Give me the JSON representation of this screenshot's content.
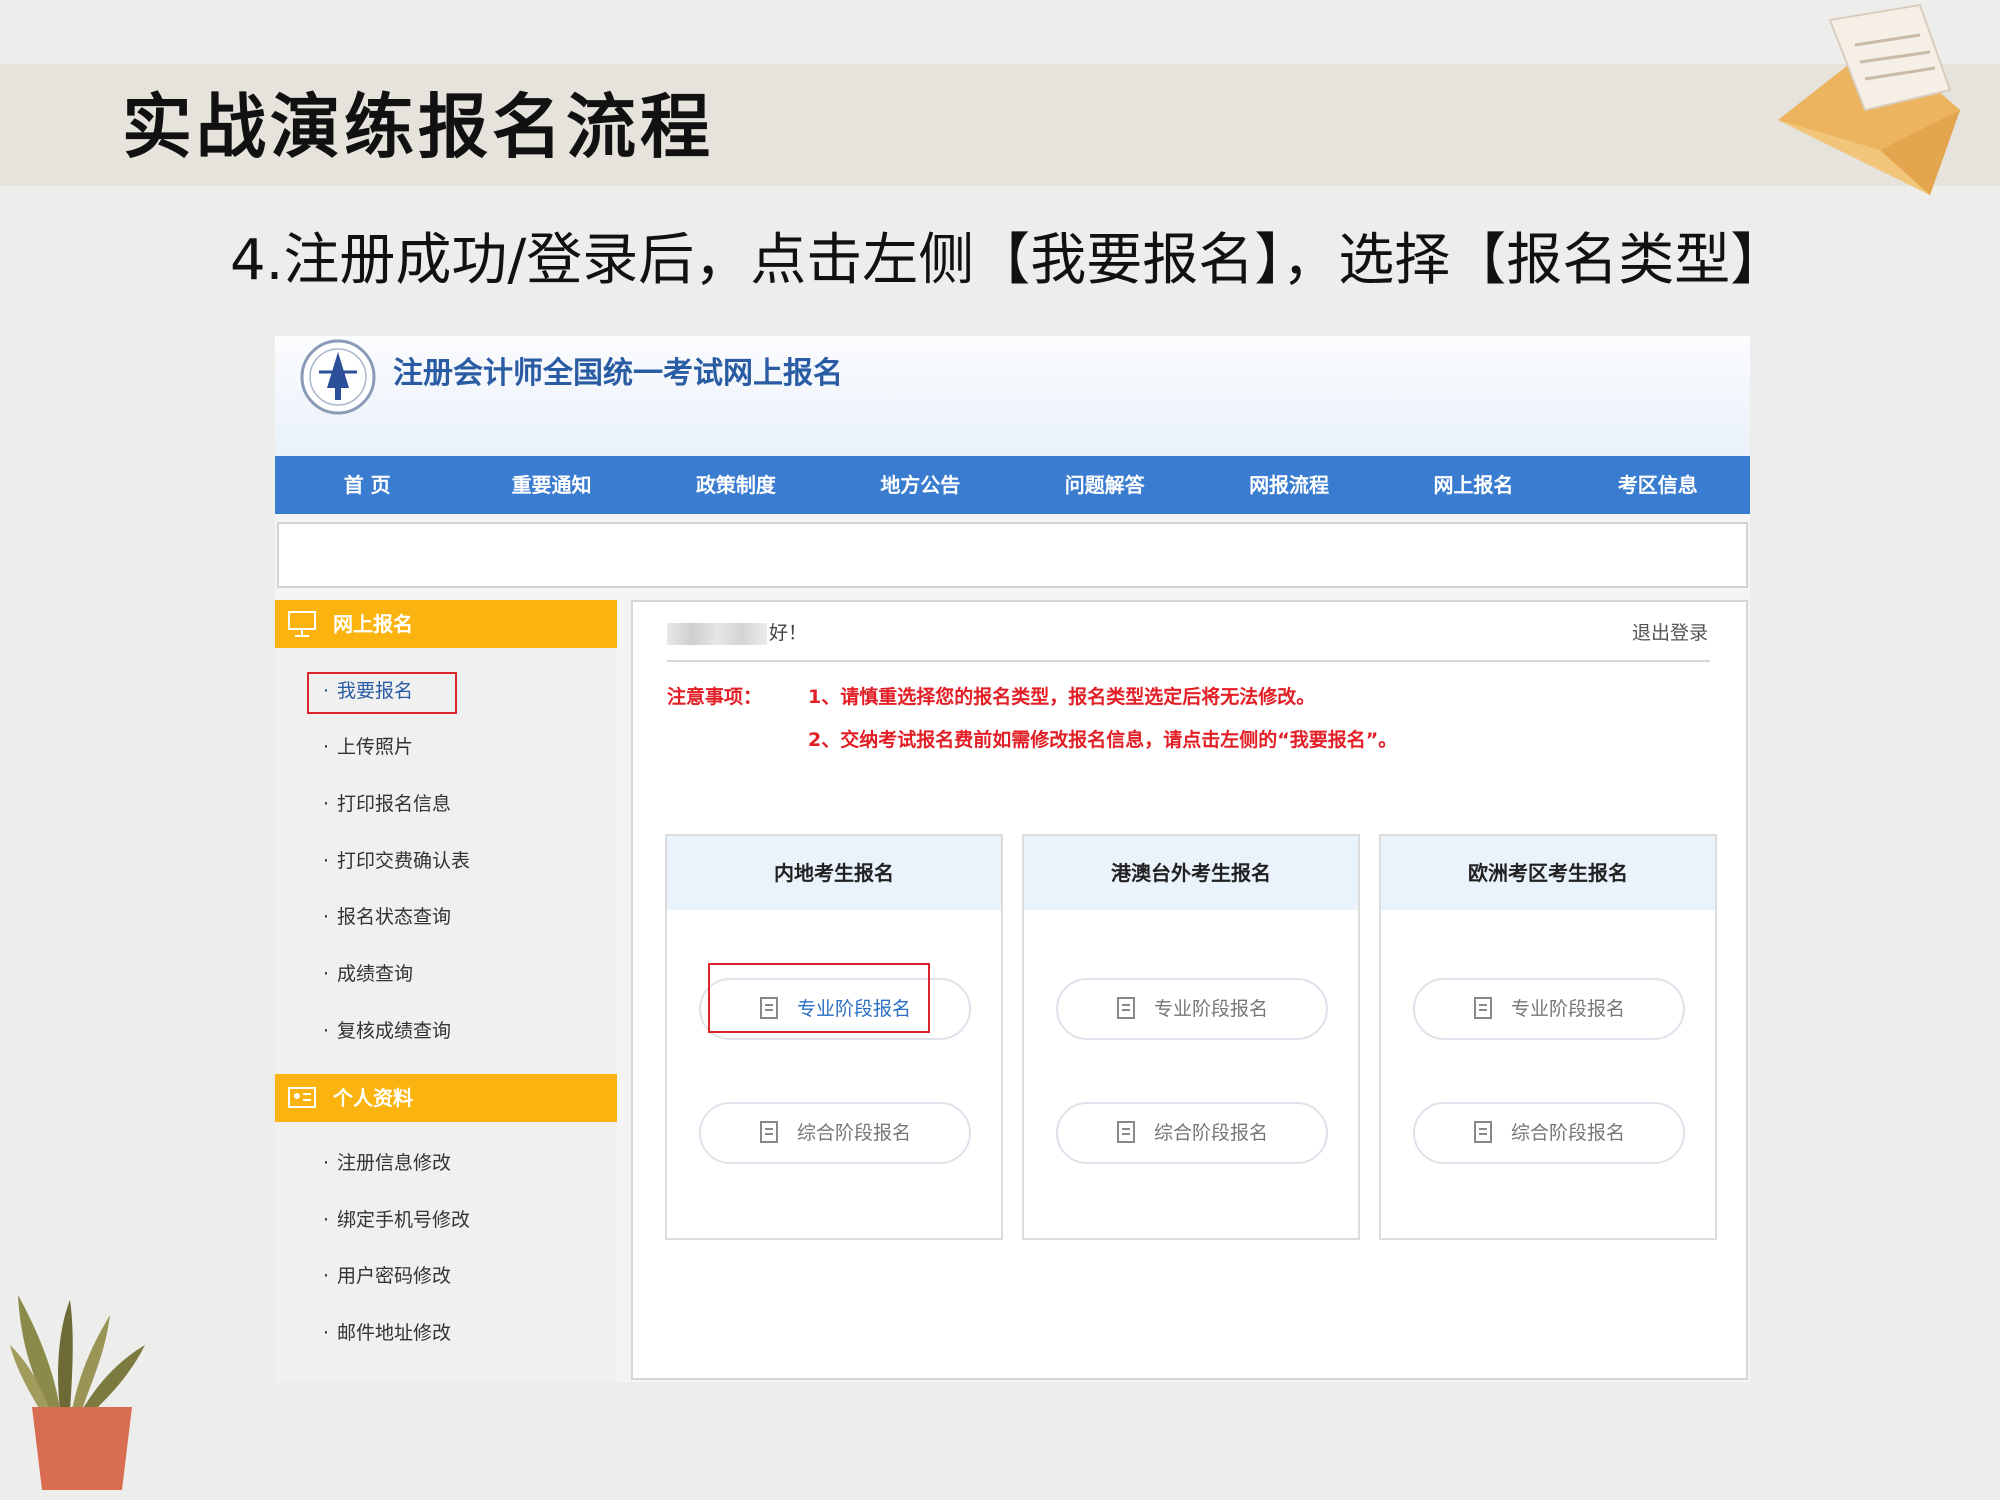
{
  "slide": {
    "title": "实战演练报名流程",
    "subtitle": "4.注册成功/登录后，点击左侧【我要报名】，选择【报名类型】"
  },
  "site": {
    "title": "注册会计师全国统一考试网上报名",
    "nav": [
      "首 页",
      "重要通知",
      "政策制度",
      "地方公告",
      "问题解答",
      "网报流程",
      "网上报名",
      "考区信息"
    ]
  },
  "sidebar": {
    "section1": {
      "label": "网上报名",
      "items": [
        "我要报名",
        "上传照片",
        "打印报名信息",
        "打印交费确认表",
        "报名状态查询",
        "成绩查询",
        "复核成绩查询"
      ]
    },
    "section2": {
      "label": "个人资料",
      "items": [
        "注册信息修改",
        "绑定手机号修改",
        "用户密码修改",
        "邮件地址修改"
      ]
    },
    "active_item": "我要报名"
  },
  "main": {
    "greeting_suffix": "好！",
    "logout": "退出登录",
    "notice_label": "注意事项：",
    "notices": [
      "1、请慎重选择您的报名类型，报名类型选定后将无法修改。",
      "2、交纳考试报名费前如需修改报名信息，请点击左侧的“我要报名”。"
    ],
    "cards": [
      {
        "title": "内地考生报名",
        "buttons": [
          "专业阶段报名",
          "综合阶段报名"
        ]
      },
      {
        "title": "港澳台外考生报名",
        "buttons": [
          "专业阶段报名",
          "综合阶段报名"
        ]
      },
      {
        "title": "欧洲考区考生报名",
        "buttons": [
          "专业阶段报名",
          "综合阶段报名"
        ]
      }
    ]
  },
  "colors": {
    "nav_blue": "#3a7ccf",
    "sidebar_orange": "#fbb40f",
    "notice_red": "#e21f26",
    "highlight_red": "#d9262c"
  }
}
